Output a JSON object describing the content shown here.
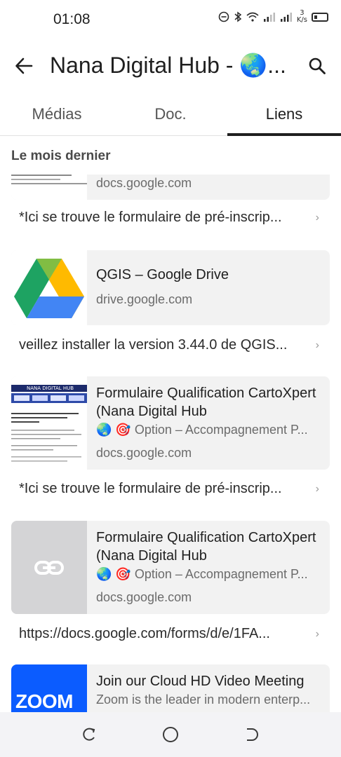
{
  "status_bar": {
    "time": "01:08",
    "net_speed_value": "3",
    "net_speed_unit": "K/s"
  },
  "header": {
    "title": "Nana Digital Hub - 🌏..."
  },
  "tabs": [
    {
      "label": "Médias",
      "active": false
    },
    {
      "label": "Doc.",
      "active": false
    },
    {
      "label": "Liens",
      "active": true
    }
  ],
  "section_label": "Le mois dernier",
  "links": [
    {
      "domain": "docs.google.com",
      "message": "*Ici se trouve le formulaire de pré-inscrip..."
    },
    {
      "title": "QGIS – Google Drive",
      "domain": "drive.google.com",
      "message": "veillez installer la version 3.44.0 de QGIS..."
    },
    {
      "title": "Formulaire Qualification CartoXpert (Nana Digital Hub",
      "description": "🌏 🎯 Option – Accompagnement P...",
      "domain": "docs.google.com",
      "message": "*Ici se trouve le formulaire de pré-inscrip...",
      "thumb_heading": "NANA DIGITAL HUB"
    },
    {
      "title": "Formulaire Qualification CartoXpert (Nana Digital Hub",
      "description": "🌏 🎯 Option – Accompagnement P...",
      "domain": "docs.google.com",
      "message": "https://docs.google.com/forms/d/e/1FA..."
    },
    {
      "title": "Join our Cloud HD Video Meeting",
      "description": "Zoom is the leader in modern enterp...",
      "logo_text": "zoom"
    }
  ],
  "colors": {
    "accent": "#1f1f1f",
    "card_bg": "#f2f2f2",
    "zoom_blue": "#0b5cff",
    "drive_green": "#1ea362",
    "drive_yellow": "#ffba00",
    "drive_blue": "#4285f4"
  }
}
